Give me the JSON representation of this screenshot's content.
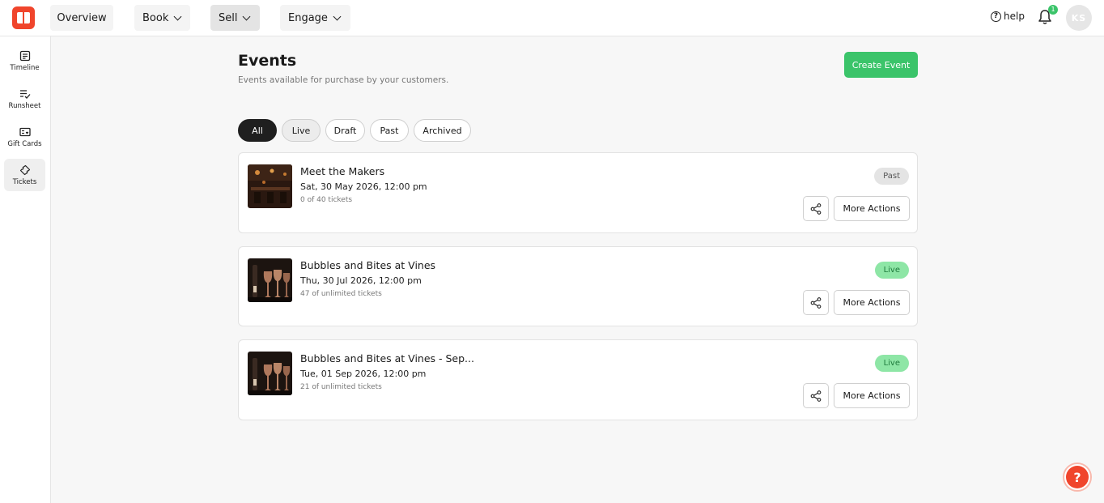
{
  "topbar": {
    "nav": [
      {
        "label": "Overview"
      },
      {
        "label": "Book"
      },
      {
        "label": "Sell"
      },
      {
        "label": "Engage"
      }
    ],
    "help_label": "help",
    "notification_count": "1",
    "avatar_initials": "KS"
  },
  "sidebar": {
    "items": [
      {
        "label": "Timeline",
        "icon": "timeline-icon"
      },
      {
        "label": "Runsheet",
        "icon": "runsheet-icon"
      },
      {
        "label": "Gift Cards",
        "icon": "gift-card-icon"
      },
      {
        "label": "Tickets",
        "icon": "ticket-icon"
      }
    ]
  },
  "main": {
    "title": "Events",
    "subtitle": "Events available for purchase by your customers.",
    "create_label": "Create Event",
    "filters": [
      {
        "label": "All"
      },
      {
        "label": "Live"
      },
      {
        "label": "Draft"
      },
      {
        "label": "Past"
      },
      {
        "label": "Archived"
      }
    ],
    "events": [
      {
        "name": "Meet the Makers",
        "date": "Sat, 30 May 2026, 12:00 pm",
        "tickets": "0 of 40 tickets",
        "status": "Past",
        "more_label": "More Actions"
      },
      {
        "name": "Bubbles and Bites at Vines",
        "date": "Thu, 30 Jul 2026, 12:00 pm",
        "tickets": "47 of unlimited tickets",
        "status": "Live",
        "more_label": "More Actions"
      },
      {
        "name": "Bubbles and Bites at Vines - Sep...",
        "date": "Tue, 01 Sep 2026, 12:00 pm",
        "tickets": "21 of unlimited tickets",
        "status": "Live",
        "more_label": "More Actions"
      }
    ]
  },
  "support_fab": "?",
  "colors": {
    "brand": "#f0452c",
    "accent_green": "#3bc46a",
    "live_badge": "#8ee6a6",
    "past_badge": "#e4e4e4"
  }
}
